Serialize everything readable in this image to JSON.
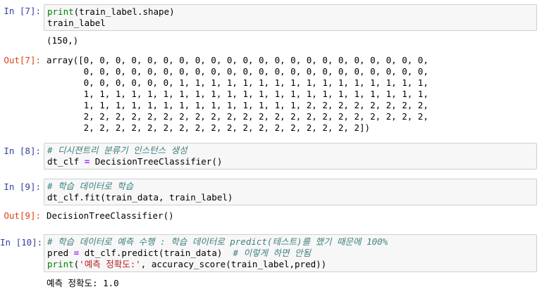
{
  "cells": [
    {
      "prompt": "In [7]:",
      "code": [
        "print(train_label.shape)",
        "train_label"
      ],
      "stream": "(150,)",
      "out_prompt": "Out[7]:",
      "output": [
        "array([0, 0, 0, 0, 0, 0, 0, 0, 0, 0, 0, 0, 0, 0, 0, 0, 0, 0, 0, 0, 0, 0,",
        "       0, 0, 0, 0, 0, 0, 0, 0, 0, 0, 0, 0, 0, 0, 0, 0, 0, 0, 0, 0, 0, 0,",
        "       0, 0, 0, 0, 0, 0, 1, 1, 1, 1, 1, 1, 1, 1, 1, 1, 1, 1, 1, 1, 1, 1,",
        "       1, 1, 1, 1, 1, 1, 1, 1, 1, 1, 1, 1, 1, 1, 1, 1, 1, 1, 1, 1, 1, 1,",
        "       1, 1, 1, 1, 1, 1, 1, 1, 1, 1, 1, 1, 1, 1, 2, 2, 2, 2, 2, 2, 2, 2,",
        "       2, 2, 2, 2, 2, 2, 2, 2, 2, 2, 2, 2, 2, 2, 2, 2, 2, 2, 2, 2, 2, 2,",
        "       2, 2, 2, 2, 2, 2, 2, 2, 2, 2, 2, 2, 2, 2, 2, 2, 2, 2])"
      ]
    },
    {
      "prompt": "In [8]:",
      "comment": "# 디시젼트리 분류기 인스턴스 생성",
      "code_lhs": "dt_clf",
      "code_rhs": "DecisionTreeClassifier()"
    },
    {
      "prompt": "In [9]:",
      "comment": "# 학습 데이터로 학습",
      "code": "dt_clf.fit(train_data, train_label)",
      "out_prompt": "Out[9]:",
      "output": "DecisionTreeClassifier()"
    },
    {
      "prompt": "In [10]:",
      "comment": "# 학습 데이터로 예측 수행 : 학습 데이터로 predict(테스트)를 했기 때문에 100%",
      "code_lhs": "pred",
      "code_rhs": "dt_clf.predict(train_data)",
      "inline_comment": "# 이렇게 하면 안됨",
      "print_fn": "print",
      "print_str": "'예측 정확도:'",
      "print_rest": ", accuracy_score(train_label,pred))",
      "stream": "예측 정확도: 1.0"
    }
  ],
  "colors": {
    "in_prompt": "#303f9f",
    "out_prompt": "#d84315",
    "builtin": "#008000",
    "comment": "#408080",
    "operator": "#aa22ff",
    "string": "#ba2121",
    "cell_bg": "#f7f7f7",
    "cell_border": "#cfcfcf"
  }
}
